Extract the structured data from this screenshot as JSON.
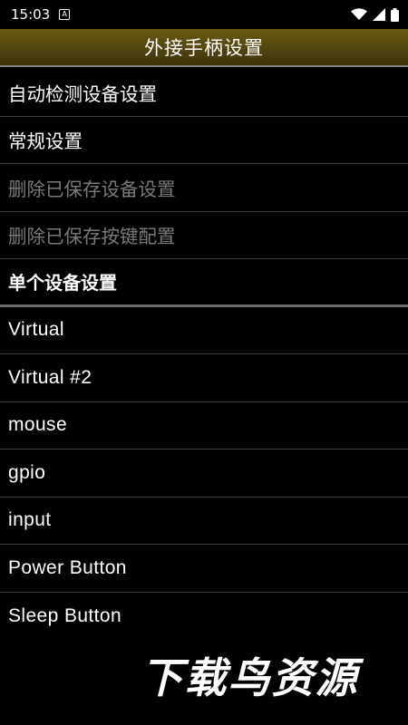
{
  "status_bar": {
    "time": "15:03",
    "notification_icon_letter": "A",
    "icons": [
      "wifi-icon",
      "signal-icon",
      "battery-icon"
    ]
  },
  "title_bar": {
    "title": "外接手柄设置"
  },
  "settings_items": [
    {
      "label": "自动检测设备设置",
      "enabled": true
    },
    {
      "label": "常规设置",
      "enabled": true
    },
    {
      "label": "删除已保存设备设置",
      "enabled": false
    },
    {
      "label": "删除已保存按键配置",
      "enabled": false
    }
  ],
  "section_header": {
    "label": "单个设备设置"
  },
  "devices": [
    {
      "label": "Virtual"
    },
    {
      "label": "Virtual #2"
    },
    {
      "label": "mouse"
    },
    {
      "label": "gpio"
    },
    {
      "label": "input"
    },
    {
      "label": "Power Button"
    },
    {
      "label": "Sleep Button"
    }
  ],
  "watermark": {
    "text": "下载鸟资源"
  },
  "colors": {
    "title_bar_top": "#6b5a12",
    "title_bar_bottom": "#3e330b",
    "background": "#000000",
    "disabled_text": "#7a7a7a",
    "divider": "#3b3b3b"
  }
}
